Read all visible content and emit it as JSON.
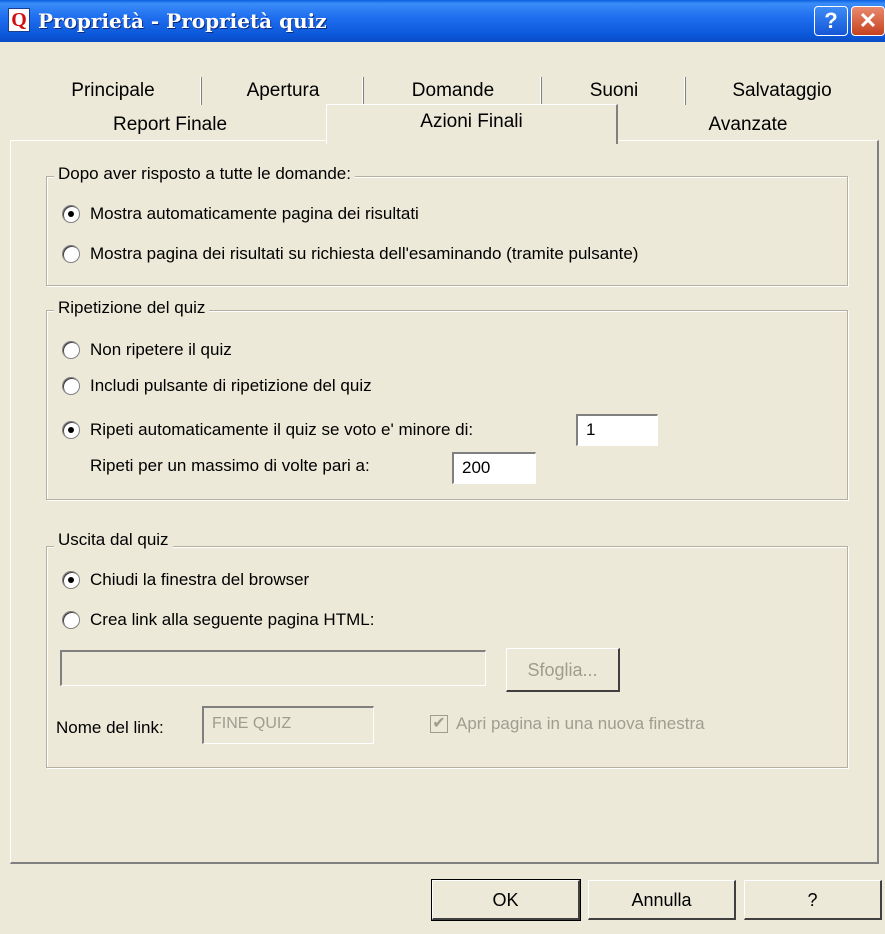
{
  "window": {
    "title": "Proprietà - Proprietà quiz",
    "app_icon_glyph": "Q",
    "help_glyph": "?",
    "close_glyph": "✕"
  },
  "tabs": {
    "row1": [
      "Principale",
      "Apertura",
      "Domande",
      "Suoni",
      "Salvataggio"
    ],
    "row2": [
      "Report Finale",
      "Azioni Finali",
      "Avanzate"
    ],
    "active": "Azioni Finali"
  },
  "group_after": {
    "legend": "Dopo aver risposto a tutte le domande:",
    "option_auto": "Mostra automaticamente pagina dei risultati",
    "option_request": "Mostra pagina dei risultati su richiesta dell'esaminando (tramite pulsante)",
    "selected": "auto"
  },
  "group_repeat": {
    "legend": "Ripetizione del quiz",
    "option_no_repeat": "Non ripetere il quiz",
    "option_button": "Includi pulsante di ripetizione del quiz",
    "option_auto": "Ripeti automaticamente il quiz se voto e' minore di:",
    "min_score_value": "1",
    "max_label": "Ripeti per un massimo di volte pari a:",
    "max_value": "200",
    "selected": "auto"
  },
  "group_exit": {
    "legend": "Uscita dal quiz",
    "option_close": "Chiudi la finestra del browser",
    "option_link": "Crea link alla seguente pagina HTML:",
    "html_page_value": "",
    "browse_label": "Sfoglia...",
    "link_name_label": "Nome del link:",
    "link_name_value": "FINE QUIZ",
    "new_window_label": "Apri pagina in una nuova finestra",
    "new_window_checked": true,
    "selected": "close"
  },
  "buttons": {
    "ok": "OK",
    "cancel": "Annulla",
    "help": "?"
  }
}
